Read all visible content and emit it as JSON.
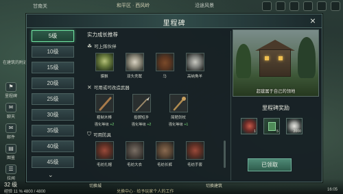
{
  "hud": {
    "location": "甘南关",
    "town": "和平区 · 西风岭",
    "top_right": "沿途风景"
  },
  "left_chat": "在建筑的附近",
  "side_buttons": [
    {
      "label": "里程碑",
      "icon": "milestone-icon"
    },
    {
      "label": "聊天",
      "icon": "chat-icon"
    },
    {
      "label": "邮件",
      "icon": "mail-icon"
    },
    {
      "label": "图鉴",
      "icon": "codex-icon"
    },
    {
      "label": "拉闻",
      "icon": "news-icon"
    }
  ],
  "bottom": {
    "level": "32 级",
    "exp": "经验 11 %  4800 / 4800",
    "center_left": "切换城",
    "center_sub": "兑换中心 · 给予玩家个人的工作",
    "center_right": "切换建筑",
    "time": "16:05"
  },
  "panel": {
    "title": "里程碑",
    "close_label": "×"
  },
  "levels": [
    "5级",
    "10级",
    "15级",
    "20级",
    "25级",
    "30级",
    "35级",
    "40级",
    "45级"
  ],
  "active_level_index": 0,
  "scroll_down": "⌄",
  "growth": {
    "section_title": "实力成长推荐",
    "companions": {
      "title": "可上阵伙伴",
      "items": [
        {
          "name": "貘貅",
          "thumb": "tree-creature-portrait"
        },
        {
          "name": "双头秃鹫",
          "thumb": "vulture-portrait"
        },
        {
          "name": "马",
          "thumb": "horse-portrait"
        },
        {
          "name": "高纳角羊",
          "thumb": "goat-portrait"
        }
      ]
    },
    "weapons": {
      "title": "可用或可改造武器",
      "items": [
        {
          "name": "粗制木棒",
          "req": "强化等级",
          "plus": "+2"
        },
        {
          "name": "投掷短矛",
          "req": "强化等级",
          "plus": "+2"
        },
        {
          "name": "简陋剑杖",
          "req": "强化等级",
          "plus": "+1"
        }
      ]
    },
    "armor": {
      "title": "可用防具",
      "items": [
        {
          "name": "毛纺扎帽"
        },
        {
          "name": "毛纺大衣"
        },
        {
          "name": "毛纺长裤"
        },
        {
          "name": "毛纺手套"
        }
      ]
    }
  },
  "preview": {
    "caption": "超建属于自己的领地"
  },
  "reward": {
    "title": "里程碑奖励",
    "items": [
      {
        "icon": "red-orb-icon",
        "count": "1"
      },
      {
        "icon": "green-card-icon",
        "count": "5"
      },
      {
        "icon": "silver-coin-icon",
        "count": "2000"
      }
    ],
    "claim_label": "已领取"
  }
}
